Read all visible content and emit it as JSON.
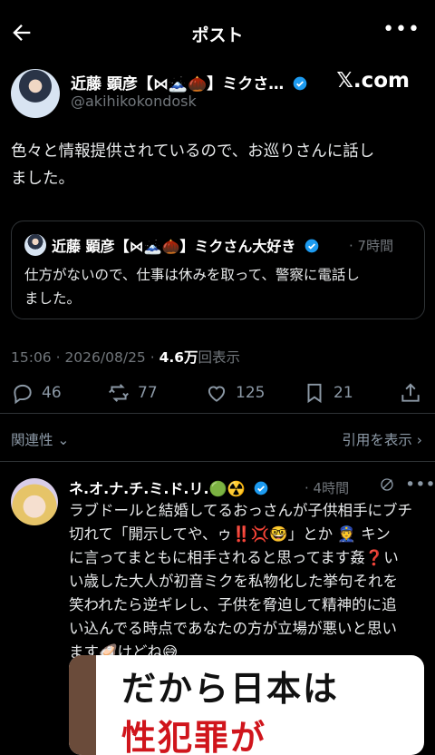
{
  "header": {
    "title": "ポスト"
  },
  "author": {
    "name": "近藤 顕彦【⋈🗻🌰】ミクさ…",
    "handle": "@akihikokondosk",
    "site_badge": "𝕏.com"
  },
  "post": {
    "text_line1": "色々と情報提供されているので、お巡りさんに話し",
    "text_line2": "ました。"
  },
  "quote": {
    "name": "近藤 顕彦【⋈🗻🌰】ミクさん大好き",
    "time": "· 7時間",
    "text_line1": "仕方がないので、仕事は休みを取って、警察に電話し",
    "text_line2": "ました。"
  },
  "meta": {
    "timestamp": "15:06 · 2026/08/25 · ",
    "views": "4.6万",
    "views_label": "回表示"
  },
  "actions": {
    "replies": "46",
    "reposts": "77",
    "likes": "125",
    "bookmarks": "21"
  },
  "sort": {
    "relevance_label": "関連性 ⌄",
    "quotes_label": "引用を表示 ›"
  },
  "reply": {
    "name": "ネ.オ.ナ.チ.ミ.ド.リ.🟢☢️",
    "time": "· 4時間",
    "line1": "ラブドールと結婚してるおっさんが子供相手にブチ",
    "line2": "切れて「開示してや、ゥ‼️💢🤓」とか 👮 キン",
    "line3": "に言ってまともに相手されると思ってます姦❓い",
    "line4": "い歳した大人が初音ミクを私物化した挙句それを",
    "line5": "笑われたら逆ギレし、子供を脅迫して精神的に追",
    "line6": "い込んでる時点であなたの方が立場が悪いと思い",
    "line7": "ます🦪けどね😅",
    "media_line1": "だから日本は",
    "media_line2": "性犯罪が"
  },
  "colors": {
    "background": "#000000",
    "verified": "#1d9bf0",
    "muted": "#71767b"
  },
  "icons": [
    "back-arrow-icon",
    "more-icon",
    "verified-icon",
    "reply-icon",
    "repost-icon",
    "like-icon",
    "bookmark-icon",
    "share-icon",
    "grok-icon"
  ]
}
